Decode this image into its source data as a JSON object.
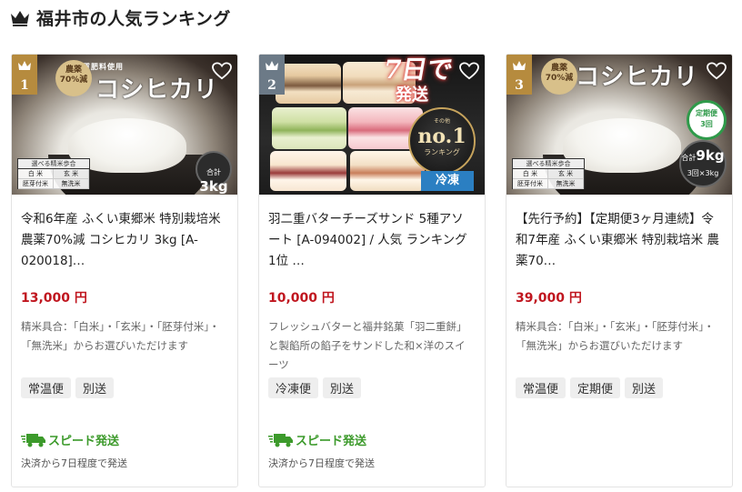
{
  "heading": {
    "title": "福井市の人気ランキング"
  },
  "colors": {
    "price": "#c0161f",
    "speed": "#3c9a2b",
    "gold": "#b68b3e",
    "silver": "#6c7a87"
  },
  "cards": [
    {
      "rank": "1",
      "rank_badge_color": "gold",
      "image": {
        "organic_text": "有機質肥料使用",
        "product_title": "コシヒカリ",
        "pesticide_badge": [
          "農薬",
          "70%減"
        ],
        "weight": "3kg",
        "weight_prefix": "合計",
        "milling_header": "選べる精米歩合",
        "milling_options": [
          "白 米",
          "玄 米",
          "胚芽付米",
          "無洗米"
        ]
      },
      "title": "令和6年産 ふくい東郷米 特別栽培米 農薬70%減 コシヒカリ 3kg [A-020018]…",
      "price": "13,000 円",
      "description": "精米具合：「白米」・「玄米」・「胚芽付米」・「無洗米」からお選びいただけます",
      "tags": [
        "常温便",
        "別送"
      ],
      "speed_label": "スピード発送",
      "speed_note": "決済から7日程度で発送"
    },
    {
      "rank": "2",
      "rank_badge_color": "silver",
      "image": {
        "headline": "7日で",
        "headline_sub": "発送",
        "no1_small": "その他",
        "no1_big": "no.1",
        "no1_label": "ランキング",
        "frozen_label": "冷凍"
      },
      "title": "羽二重バターチーズサンド 5種アソート [A-094002] / 人気 ランキング 1位 …",
      "price": "10,000 円",
      "description": "フレッシュバターと福井銘菓「羽二重餅」と製餡所の餡子をサンドした和×洋のスイーツ",
      "tags": [
        "冷凍便",
        "別送"
      ],
      "speed_label": "スピード発送",
      "speed_note": "決済から7日程度で発送"
    },
    {
      "rank": "3",
      "rank_badge_color": "gold",
      "image": {
        "product_title": "コシヒカリ",
        "pesticide_badge": [
          "農薬",
          "70%減"
        ],
        "subscription": [
          "定期便",
          "3回"
        ],
        "weight": "9kg",
        "weight_prefix": "合計",
        "weight_sub": "3回×3kg",
        "milling_header": "選べる精米歩合",
        "milling_options": [
          "白 米",
          "玄 米",
          "胚芽付米",
          "無洗米"
        ]
      },
      "title": "【先行予約】【定期便3ヶ月連続】令和7年産 ふくい東郷米 特別栽培米 農薬70…",
      "price": "39,000 円",
      "description": "精米具合：「白米」・「玄米」・「胚芽付米」・「無洗米」からお選びいただけます",
      "tags": [
        "常温便",
        "定期便",
        "別送"
      ],
      "speed_label": "",
      "speed_note": ""
    }
  ]
}
